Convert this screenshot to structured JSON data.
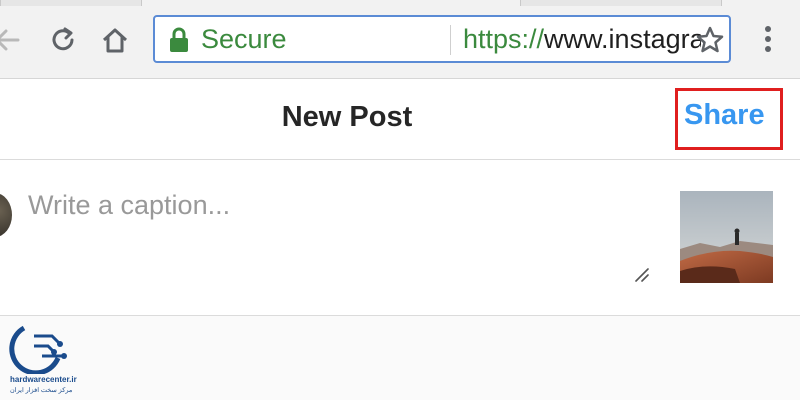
{
  "browser": {
    "address_bar": {
      "security_label": "Secure",
      "url_scheme": "https://",
      "url_rest": "www.instagram.com/cr"
    }
  },
  "post": {
    "title": "New Post",
    "share_label": "Share",
    "caption_placeholder": "Write a caption..."
  },
  "watermark": {
    "domain": "hardwarecenter.ir",
    "tagline": "مرکز سخت افزار ایران"
  },
  "colors": {
    "secure_green": "#3b8a3e",
    "share_blue": "#3897f0",
    "highlight_red": "#e01f1f"
  },
  "icons": [
    "back-arrow-icon",
    "reload-icon",
    "home-icon",
    "lock-icon",
    "star-icon",
    "menu-dots-icon",
    "resize-handle-icon"
  ]
}
